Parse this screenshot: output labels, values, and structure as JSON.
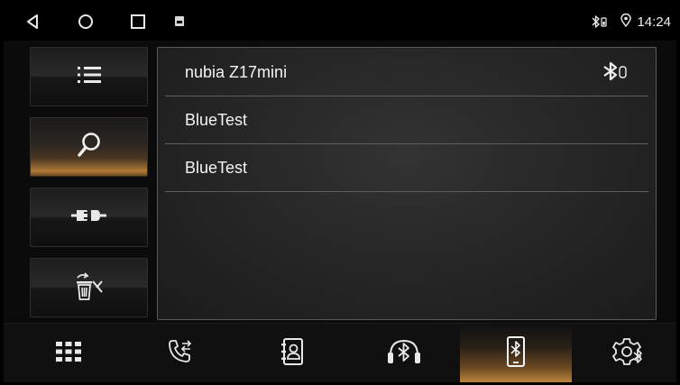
{
  "status_bar": {
    "nav_buttons": [
      "back-icon",
      "home-icon",
      "recents-icon"
    ],
    "notification_icon": "notification-icon",
    "bluetooth_status_icon": "bluetooth-connected-icon",
    "location_icon": "location-icon",
    "time": "14:24"
  },
  "side_actions": [
    {
      "name": "device-list-button",
      "icon": "list-icon",
      "active": false
    },
    {
      "name": "search-button",
      "icon": "search-icon",
      "active": true
    },
    {
      "name": "connect-button",
      "icon": "plug-icon",
      "active": false
    },
    {
      "name": "delete-button",
      "icon": "trash-icon",
      "active": false
    }
  ],
  "devices": [
    {
      "name": "nubia Z17mini",
      "connected": true
    },
    {
      "name": "BlueTest",
      "connected": false
    },
    {
      "name": "BlueTest",
      "connected": false
    }
  ],
  "bottom_nav": [
    {
      "name": "dialpad-tab",
      "icon": "dialpad-icon",
      "active": false
    },
    {
      "name": "call-log-tab",
      "icon": "call-log-icon",
      "active": false
    },
    {
      "name": "contacts-tab",
      "icon": "contacts-icon",
      "active": false
    },
    {
      "name": "bt-music-tab",
      "icon": "bluetooth-music-icon",
      "active": false
    },
    {
      "name": "bt-devices-tab",
      "icon": "bluetooth-phone-icon",
      "active": true
    },
    {
      "name": "bt-settings-tab",
      "icon": "bluetooth-settings-icon",
      "active": false
    }
  ],
  "colors": {
    "accent": "#c0883e",
    "panel_border": "#5a5a5a",
    "text": "#f4f4f4"
  }
}
